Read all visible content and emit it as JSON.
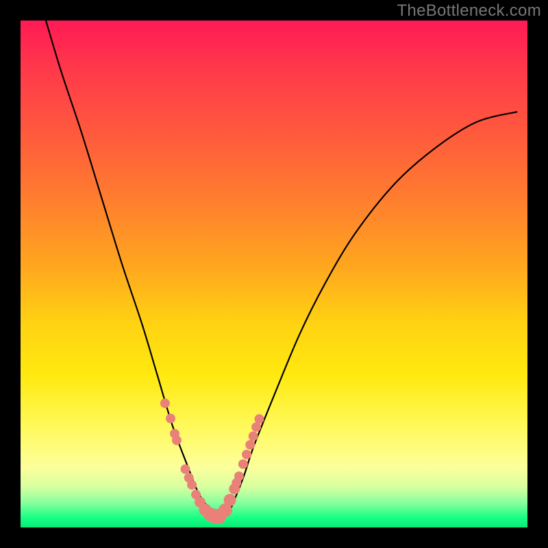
{
  "watermark": "TheBottleneck.com",
  "colors": {
    "background": "#000000",
    "curve": "#000000",
    "marker_fill": "#e98179",
    "gradient_top": "#ff1a55",
    "gradient_bottom": "#06eb78"
  },
  "chart_data": {
    "type": "line",
    "title": "",
    "xlabel": "",
    "ylabel": "",
    "xlim": [
      0,
      100
    ],
    "ylim": [
      0,
      100
    ],
    "grid": false,
    "legend": false,
    "series": [
      {
        "name": "bottleneck-curve",
        "x": [
          5,
          8,
          12,
          16,
          20,
          24,
          27,
          30,
          33,
          35,
          37,
          39,
          41,
          42,
          44,
          46,
          50,
          55,
          60,
          66,
          74,
          82,
          90,
          98
        ],
        "y": [
          100,
          90,
          78,
          65,
          52,
          40,
          30,
          20,
          12,
          7,
          4,
          2,
          3,
          5,
          10,
          16,
          26,
          38,
          48,
          58,
          68,
          75,
          80,
          82
        ]
      }
    ],
    "markers": {
      "name": "highlight-points",
      "x": [
        28.5,
        29.6,
        30.4,
        30.8,
        32.5,
        33.2,
        33.8,
        34.6,
        35.4,
        36.4,
        37.4,
        38.4,
        39.1,
        40.4,
        41.3,
        42.2,
        42.6,
        43.1,
        43.9,
        44.6,
        45.3,
        45.9,
        46.5,
        47.1
      ],
      "y": [
        24.5,
        21.5,
        18.5,
        17.2,
        11.5,
        9.8,
        8.4,
        6.5,
        5.0,
        3.5,
        2.6,
        2.2,
        2.2,
        3.4,
        5.4,
        7.6,
        8.8,
        10.1,
        12.5,
        14.4,
        16.3,
        18.0,
        19.8,
        21.4
      ],
      "r": [
        7,
        7,
        7,
        7,
        7,
        7,
        7,
        7,
        8,
        9,
        10,
        11,
        11,
        10,
        9,
        8,
        7,
        7,
        7,
        7,
        7,
        7,
        7,
        7
      ]
    }
  }
}
